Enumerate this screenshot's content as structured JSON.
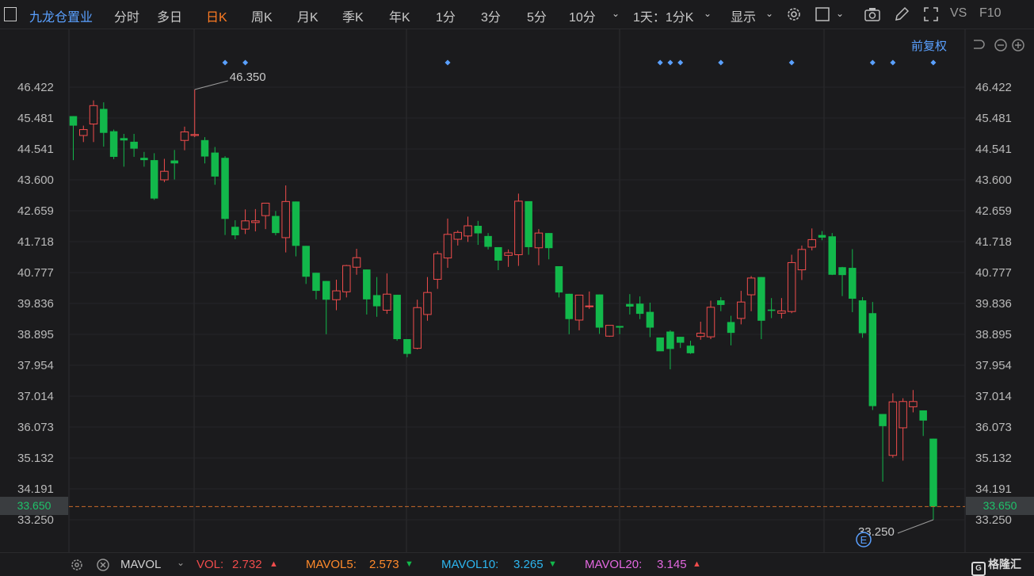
{
  "toolbar": {
    "title": "九龙仓置业",
    "periods": [
      "分时",
      "多日",
      "日K",
      "周K",
      "月K",
      "季K",
      "年K",
      "1分",
      "3分",
      "5分",
      "10分"
    ],
    "active_period": "日K",
    "range_select": "1天：1分K",
    "display_label": "显示",
    "vs_label": "VS",
    "f10_label": "F10"
  },
  "chart_header": {
    "adjust_label": "前复权"
  },
  "chart_data": {
    "type": "candlestick",
    "y_ticks": [
      "46.422",
      "45.481",
      "44.541",
      "43.600",
      "42.659",
      "41.718",
      "40.777",
      "39.836",
      "38.895",
      "37.954",
      "37.014",
      "36.073",
      "35.132",
      "34.191",
      "33.250"
    ],
    "ylim": [
      33.25,
      46.422
    ],
    "high_label": "46.350",
    "low_label": "33.250",
    "current_price": "33.650",
    "event_marker": "E",
    "candles": [
      {
        "o": 45.54,
        "h": 45.54,
        "l": 44.2,
        "c": 45.25
      },
      {
        "o": 44.95,
        "h": 45.25,
        "l": 44.75,
        "c": 45.13
      },
      {
        "o": 45.3,
        "h": 46.02,
        "l": 44.75,
        "c": 45.86
      },
      {
        "o": 45.76,
        "h": 45.96,
        "l": 44.61,
        "c": 45.03
      },
      {
        "o": 45.08,
        "h": 45.13,
        "l": 44.23,
        "c": 44.3
      },
      {
        "o": 44.87,
        "h": 45.0,
        "l": 44.0,
        "c": 44.8
      },
      {
        "o": 44.76,
        "h": 45.0,
        "l": 44.3,
        "c": 44.55
      },
      {
        "o": 44.27,
        "h": 44.45,
        "l": 44.0,
        "c": 44.2
      },
      {
        "o": 44.2,
        "h": 44.41,
        "l": 42.99,
        "c": 43.03
      },
      {
        "o": 43.6,
        "h": 44.24,
        "l": 43.53,
        "c": 43.86
      },
      {
        "o": 44.19,
        "h": 44.51,
        "l": 43.61,
        "c": 44.1
      },
      {
        "o": 44.8,
        "h": 45.22,
        "l": 44.5,
        "c": 45.06
      },
      {
        "o": 44.95,
        "h": 46.35,
        "l": 44.9,
        "c": 44.98
      },
      {
        "o": 44.81,
        "h": 44.9,
        "l": 44.1,
        "c": 44.31
      },
      {
        "o": 44.43,
        "h": 44.6,
        "l": 43.45,
        "c": 43.7
      },
      {
        "o": 44.27,
        "h": 44.32,
        "l": 41.92,
        "c": 42.41
      },
      {
        "o": 42.17,
        "h": 42.37,
        "l": 41.79,
        "c": 41.91
      },
      {
        "o": 42.1,
        "h": 42.7,
        "l": 41.95,
        "c": 42.35
      },
      {
        "o": 42.3,
        "h": 42.71,
        "l": 42.03,
        "c": 42.35
      },
      {
        "o": 42.51,
        "h": 42.9,
        "l": 42.1,
        "c": 42.89
      },
      {
        "o": 42.5,
        "h": 42.65,
        "l": 41.91,
        "c": 41.98
      },
      {
        "o": 41.84,
        "h": 43.43,
        "l": 41.39,
        "c": 42.94
      },
      {
        "o": 42.94,
        "h": 42.94,
        "l": 41.27,
        "c": 41.59
      },
      {
        "o": 41.59,
        "h": 41.59,
        "l": 40.43,
        "c": 40.65
      },
      {
        "o": 40.77,
        "h": 40.77,
        "l": 39.96,
        "c": 40.22
      },
      {
        "o": 40.52,
        "h": 40.52,
        "l": 38.9,
        "c": 39.95
      },
      {
        "o": 39.95,
        "h": 40.56,
        "l": 39.63,
        "c": 40.22
      },
      {
        "o": 40.19,
        "h": 41.01,
        "l": 40.02,
        "c": 40.99
      },
      {
        "o": 40.94,
        "h": 41.5,
        "l": 40.71,
        "c": 41.23
      },
      {
        "o": 40.87,
        "h": 40.87,
        "l": 39.5,
        "c": 39.96
      },
      {
        "o": 40.09,
        "h": 40.64,
        "l": 39.43,
        "c": 39.75
      },
      {
        "o": 39.63,
        "h": 40.75,
        "l": 39.52,
        "c": 40.12
      },
      {
        "o": 40.1,
        "h": 40.1,
        "l": 38.7,
        "c": 38.75
      },
      {
        "o": 38.75,
        "h": 38.75,
        "l": 38.2,
        "c": 38.3
      },
      {
        "o": 38.47,
        "h": 39.95,
        "l": 38.44,
        "c": 39.71
      },
      {
        "o": 39.5,
        "h": 40.64,
        "l": 39.31,
        "c": 40.17
      },
      {
        "o": 40.57,
        "h": 41.43,
        "l": 40.28,
        "c": 41.35
      },
      {
        "o": 41.22,
        "h": 42.42,
        "l": 40.92,
        "c": 41.94
      },
      {
        "o": 41.79,
        "h": 42.06,
        "l": 41.6,
        "c": 42.0
      },
      {
        "o": 41.89,
        "h": 42.48,
        "l": 41.71,
        "c": 42.2
      },
      {
        "o": 42.2,
        "h": 42.35,
        "l": 41.62,
        "c": 41.97
      },
      {
        "o": 41.89,
        "h": 41.98,
        "l": 41.48,
        "c": 41.56
      },
      {
        "o": 41.55,
        "h": 41.55,
        "l": 40.85,
        "c": 41.14
      },
      {
        "o": 41.3,
        "h": 41.48,
        "l": 40.95,
        "c": 41.38
      },
      {
        "o": 41.32,
        "h": 43.18,
        "l": 40.98,
        "c": 42.95
      },
      {
        "o": 42.95,
        "h": 42.95,
        "l": 41.32,
        "c": 41.55
      },
      {
        "o": 41.53,
        "h": 42.1,
        "l": 41.0,
        "c": 41.98
      },
      {
        "o": 41.98,
        "h": 41.98,
        "l": 41.18,
        "c": 41.52
      },
      {
        "o": 40.97,
        "h": 40.97,
        "l": 40.02,
        "c": 40.17
      },
      {
        "o": 40.13,
        "h": 40.13,
        "l": 38.9,
        "c": 39.36
      },
      {
        "o": 39.33,
        "h": 40.1,
        "l": 39.02,
        "c": 40.09
      },
      {
        "o": 39.75,
        "h": 40.2,
        "l": 39.67,
        "c": 39.76
      },
      {
        "o": 40.11,
        "h": 40.11,
        "l": 38.91,
        "c": 39.1
      },
      {
        "o": 38.84,
        "h": 39.15,
        "l": 38.82,
        "c": 39.17
      },
      {
        "o": 39.15,
        "h": 39.15,
        "l": 38.9,
        "c": 39.1
      },
      {
        "o": 39.82,
        "h": 40.12,
        "l": 39.5,
        "c": 39.74
      },
      {
        "o": 39.83,
        "h": 40.05,
        "l": 39.36,
        "c": 39.52
      },
      {
        "o": 39.58,
        "h": 39.86,
        "l": 38.81,
        "c": 39.1
      },
      {
        "o": 38.8,
        "h": 38.8,
        "l": 38.42,
        "c": 38.38
      },
      {
        "o": 38.98,
        "h": 39.02,
        "l": 37.83,
        "c": 38.45
      },
      {
        "o": 38.82,
        "h": 38.82,
        "l": 38.48,
        "c": 38.64
      },
      {
        "o": 38.55,
        "h": 38.7,
        "l": 38.3,
        "c": 38.32
      },
      {
        "o": 38.83,
        "h": 39.28,
        "l": 38.73,
        "c": 38.93
      },
      {
        "o": 38.82,
        "h": 39.92,
        "l": 38.75,
        "c": 39.72
      },
      {
        "o": 39.93,
        "h": 40.03,
        "l": 39.6,
        "c": 39.79
      },
      {
        "o": 39.27,
        "h": 39.46,
        "l": 38.56,
        "c": 38.94
      },
      {
        "o": 39.38,
        "h": 40.22,
        "l": 39.2,
        "c": 39.88
      },
      {
        "o": 40.1,
        "h": 40.67,
        "l": 39.6,
        "c": 40.61
      },
      {
        "o": 40.64,
        "h": 40.64,
        "l": 38.75,
        "c": 39.31
      },
      {
        "o": 39.65,
        "h": 40.0,
        "l": 39.39,
        "c": 39.61
      },
      {
        "o": 39.54,
        "h": 40.0,
        "l": 39.38,
        "c": 39.61
      },
      {
        "o": 39.59,
        "h": 41.32,
        "l": 39.54,
        "c": 41.08
      },
      {
        "o": 40.86,
        "h": 41.6,
        "l": 40.55,
        "c": 41.48
      },
      {
        "o": 41.55,
        "h": 42.12,
        "l": 41.45,
        "c": 41.78
      },
      {
        "o": 41.92,
        "h": 42.04,
        "l": 41.76,
        "c": 41.84
      },
      {
        "o": 41.88,
        "h": 41.98,
        "l": 40.7,
        "c": 40.71
      },
      {
        "o": 40.94,
        "h": 40.95,
        "l": 40.06,
        "c": 40.7
      },
      {
        "o": 40.92,
        "h": 41.49,
        "l": 39.57,
        "c": 39.98
      },
      {
        "o": 39.93,
        "h": 40.03,
        "l": 38.79,
        "c": 38.93
      },
      {
        "o": 39.54,
        "h": 39.88,
        "l": 36.59,
        "c": 36.71
      },
      {
        "o": 36.47,
        "h": 36.47,
        "l": 34.41,
        "c": 36.1
      },
      {
        "o": 35.21,
        "h": 37.1,
        "l": 35.14,
        "c": 36.84
      },
      {
        "o": 36.05,
        "h": 36.95,
        "l": 35.05,
        "c": 36.85
      },
      {
        "o": 36.69,
        "h": 37.2,
        "l": 36.52,
        "c": 36.85
      },
      {
        "o": 36.58,
        "h": 36.58,
        "l": 35.8,
        "c": 36.27
      },
      {
        "o": 35.72,
        "h": 35.72,
        "l": 33.25,
        "c": 33.65
      }
    ],
    "marker_candles": [
      15,
      17,
      37,
      58,
      59,
      60,
      64,
      71,
      79,
      81,
      85
    ]
  },
  "indicator": {
    "name": "MAVOL",
    "vol_label": "VOL:",
    "vol_value": "2.732",
    "mavol5_label": "MAVOL5:",
    "mavol5_value": "2.573",
    "mavol10_label": "MAVOL10:",
    "mavol10_value": "3.265",
    "mavol20_label": "MAVOL20:",
    "mavol20_value": "3.145"
  },
  "logo_text": "格隆汇",
  "colors": {
    "up": "#f04c4c",
    "down": "#12b84b",
    "accent": "#5aa0ff",
    "active_tab": "#ff7b22",
    "current_line": "#c96a2a"
  }
}
